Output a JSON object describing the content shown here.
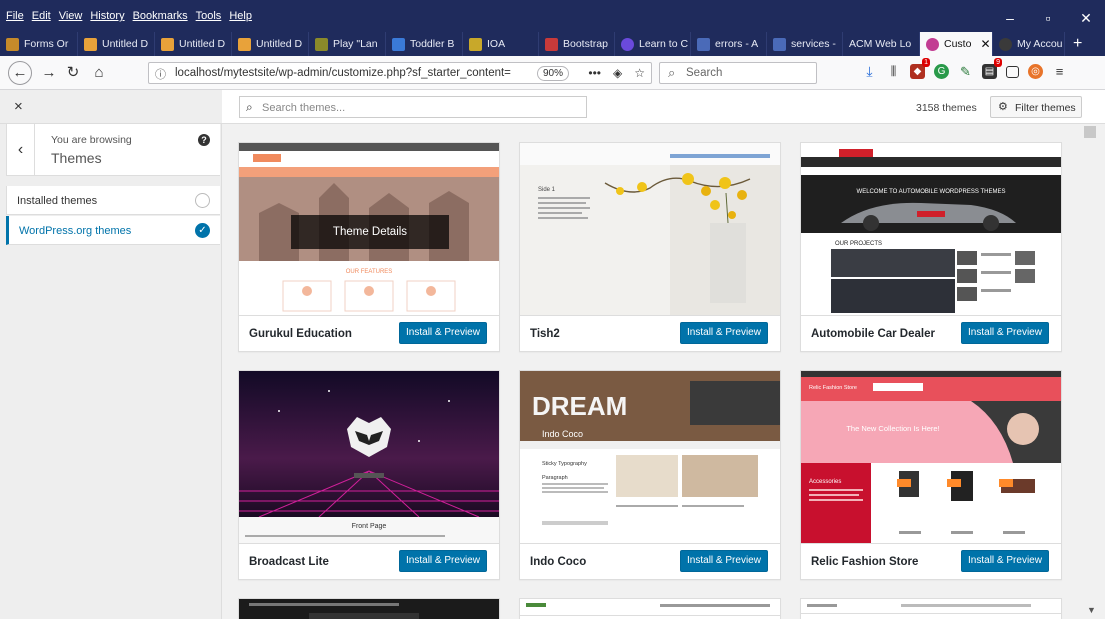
{
  "browser": {
    "menu": [
      "File",
      "Edit",
      "View",
      "History",
      "Bookmarks",
      "Tools",
      "Help"
    ],
    "tabs": [
      {
        "label": "Forms Or",
        "color": "#c58a2a"
      },
      {
        "label": "Untitled D",
        "color": "#e8a23a"
      },
      {
        "label": "Untitled D",
        "color": "#e8a23a"
      },
      {
        "label": "Untitled D",
        "color": "#e8a23a"
      },
      {
        "label": "Play \"Lan",
        "color": "#8a8a2a"
      },
      {
        "label": "Toddler B",
        "color": "#3a7ad8"
      },
      {
        "label": "IOA",
        "color": "#c8a82a"
      },
      {
        "label": "Bootstrap",
        "color": "#c83a3a"
      },
      {
        "label": "Learn to C",
        "color": "#6a4adc"
      },
      {
        "label": "errors - A",
        "color": "#4a6ab8"
      },
      {
        "label": "services -",
        "color": "#4a6ab8"
      },
      {
        "label": "ACM Web Lo",
        "color": ""
      },
      {
        "label": "Custo",
        "color": "#c23c92",
        "active": true
      },
      {
        "label": "My Accou",
        "color": "#3a3a3a"
      }
    ],
    "url": "localhost/mytestsite/wp-admin/customize.php?sf_starter_content=",
    "zoom": "90%",
    "search_placeholder": "Search",
    "extension_badges": [
      "1",
      "9"
    ]
  },
  "sidebar": {
    "close_label": "×",
    "browsing_pre": "You are browsing",
    "browsing_title": "Themes",
    "filters": [
      {
        "label": "Installed themes",
        "selected": false
      },
      {
        "label": "WordPress.org themes",
        "selected": true
      }
    ]
  },
  "main": {
    "search_placeholder": "Search themes...",
    "theme_count": "3158 themes",
    "filter_label": "Filter themes",
    "theme_details_label": "Theme Details",
    "install_label": "Install & Preview",
    "themes": [
      {
        "name": "Gurukul Education"
      },
      {
        "name": "Tish2"
      },
      {
        "name": "Automobile Car Dealer"
      },
      {
        "name": "Broadcast Lite"
      },
      {
        "name": "Indo Coco"
      },
      {
        "name": "Relic Fashion Store"
      }
    ],
    "preview_text": {
      "tish_side": "Side 1",
      "auto_banner": "WELCOME TO AUTOMOBILE WORDPRESS THEMES",
      "auto_projects": "OUR PROJECTS",
      "gurukul_features": "OUR FEATURES",
      "broadcast_front": "Front Page",
      "indo_dream": "DREAM",
      "indo_name": "Indo Coco",
      "indo_sticky": "Sticky Typography",
      "indo_para": "Paragraph",
      "relic_head": "Relic Fashion Store",
      "relic_banner": "The New Collection Is Here!",
      "relic_acc": "Accessories"
    }
  }
}
